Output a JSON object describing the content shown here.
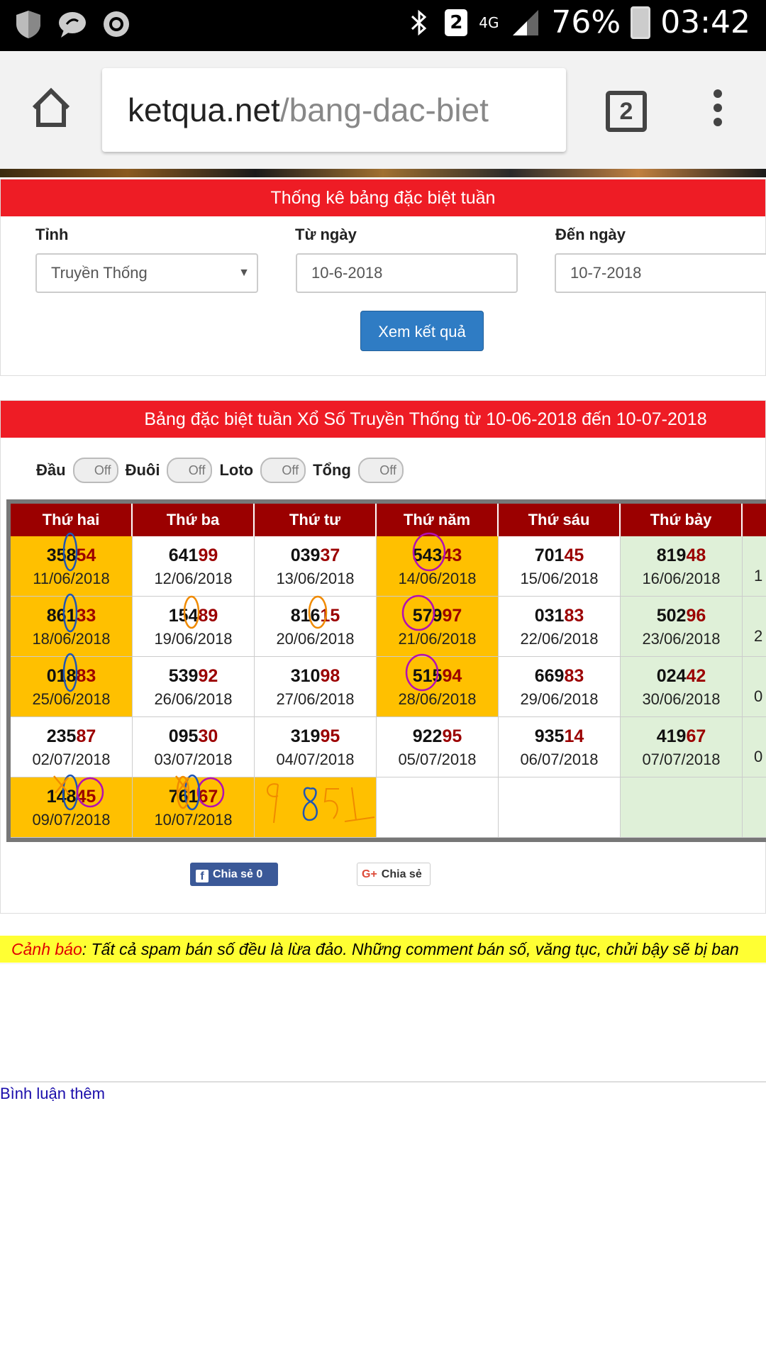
{
  "status_bar": {
    "sim_badge": "2",
    "network": "4G",
    "battery": "76%",
    "time": "03:42",
    "left_icons": [
      "shield-icon",
      "chat-bubble-icon",
      "camera-aperture-icon"
    ],
    "right_icons": [
      "bluetooth-icon",
      "signal-icon",
      "battery-icon"
    ]
  },
  "browser": {
    "url_host": "ketqua.net",
    "url_path": "/bang-dac-biet",
    "tab_count": "2"
  },
  "filter_panel": {
    "title": "Thống kê bảng đặc biệt tuần",
    "province_label": "Tỉnh",
    "province_value": "Truyền Thống",
    "from_label": "Từ ngày",
    "from_value": "10-6-2018",
    "to_label": "Đến ngày",
    "to_value": "10-7-2018",
    "submit_label": "Xem kết quả"
  },
  "results_panel": {
    "title": "Bảng đặc biệt tuần Xổ Số Truyền Thống từ 10-06-2018 đến 10-07-2018",
    "toggles": [
      {
        "label": "Đầu",
        "state": "Off"
      },
      {
        "label": "Đuôi",
        "state": "Off"
      },
      {
        "label": "Loto",
        "state": "Off"
      },
      {
        "label": "Tổng",
        "state": "Off"
      }
    ],
    "columns": [
      "Thứ hai",
      "Thứ ba",
      "Thứ tư",
      "Thứ năm",
      "Thứ sáu",
      "Thứ bảy"
    ],
    "rows": [
      [
        {
          "head": "358",
          "tail": "54",
          "date": "11/06/2018",
          "bg": "#ffc000"
        },
        {
          "head": "641",
          "tail": "99",
          "date": "12/06/2018",
          "bg": "#ffffff"
        },
        {
          "head": "039",
          "tail": "37",
          "date": "13/06/2018",
          "bg": "#ffffff"
        },
        {
          "head": "543",
          "tail": "43",
          "date": "14/06/2018",
          "bg": "#ffc000"
        },
        {
          "head": "701",
          "tail": "45",
          "date": "15/06/2018",
          "bg": "#ffffff"
        },
        {
          "head": "819",
          "tail": "48",
          "date": "16/06/2018",
          "bg": "#dff0d8"
        }
      ],
      [
        {
          "head": "861",
          "tail": "33",
          "date": "18/06/2018",
          "bg": "#ffc000"
        },
        {
          "head": "154",
          "tail": "89",
          "date": "19/06/2018",
          "bg": "#ffffff"
        },
        {
          "head": "816",
          "tail": "15",
          "date": "20/06/2018",
          "bg": "#ffffff"
        },
        {
          "head": "579",
          "tail": "97",
          "date": "21/06/2018",
          "bg": "#ffc000"
        },
        {
          "head": "031",
          "tail": "83",
          "date": "22/06/2018",
          "bg": "#ffffff"
        },
        {
          "head": "502",
          "tail": "96",
          "date": "23/06/2018",
          "bg": "#dff0d8"
        }
      ],
      [
        {
          "head": "018",
          "tail": "83",
          "date": "25/06/2018",
          "bg": "#ffc000"
        },
        {
          "head": "539",
          "tail": "92",
          "date": "26/06/2018",
          "bg": "#ffffff"
        },
        {
          "head": "310",
          "tail": "98",
          "date": "27/06/2018",
          "bg": "#ffffff"
        },
        {
          "head": "515",
          "tail": "94",
          "date": "28/06/2018",
          "bg": "#ffc000"
        },
        {
          "head": "669",
          "tail": "83",
          "date": "29/06/2018",
          "bg": "#ffffff"
        },
        {
          "head": "024",
          "tail": "42",
          "date": "30/06/2018",
          "bg": "#dff0d8"
        }
      ],
      [
        {
          "head": "235",
          "tail": "87",
          "date": "02/07/2018",
          "bg": "#ffffff"
        },
        {
          "head": "095",
          "tail": "30",
          "date": "03/07/2018",
          "bg": "#ffffff"
        },
        {
          "head": "319",
          "tail": "95",
          "date": "04/07/2018",
          "bg": "#ffffff"
        },
        {
          "head": "922",
          "tail": "95",
          "date": "05/07/2018",
          "bg": "#ffffff"
        },
        {
          "head": "935",
          "tail": "14",
          "date": "06/07/2018",
          "bg": "#ffffff"
        },
        {
          "head": "419",
          "tail": "67",
          "date": "07/07/2018",
          "bg": "#dff0d8"
        }
      ],
      [
        {
          "head": "148",
          "tail": "45",
          "date": "09/07/2018",
          "bg": "#ffc000"
        },
        {
          "head": "761",
          "tail": "67",
          "date": "10/07/2018",
          "bg": "#ffc000"
        },
        {
          "head": "",
          "tail": "",
          "date": "",
          "bg": "#ffc000"
        },
        {
          "head": "",
          "tail": "",
          "date": "",
          "bg": "#ffffff"
        },
        {
          "head": "",
          "tail": "",
          "date": "",
          "bg": "#ffffff"
        },
        {
          "head": "",
          "tail": "",
          "date": "",
          "bg": "#dff0d8"
        }
      ]
    ],
    "partial_column_fragments": [
      "1",
      "2",
      "0",
      "0"
    ],
    "handwritten_note": "9851"
  },
  "share": {
    "facebook_label": "Chia sẻ 0",
    "google_label": "Chia sẻ"
  },
  "warning": {
    "label": "Cảnh báo",
    "text": ": Tất cả spam bán số đều là lừa đảo. Những comment bán số, văng tục, chửi bậy sẽ bị ban"
  },
  "comments": {
    "more_link": "Bình luận thêm"
  },
  "colors": {
    "red_header": "#ee1c25",
    "dark_red": "#9b0000",
    "highlight_orange": "#ffc000",
    "saturday_green": "#dff0d8",
    "button_blue": "#2f7cc4",
    "warning_yellow": "#ffff33"
  }
}
